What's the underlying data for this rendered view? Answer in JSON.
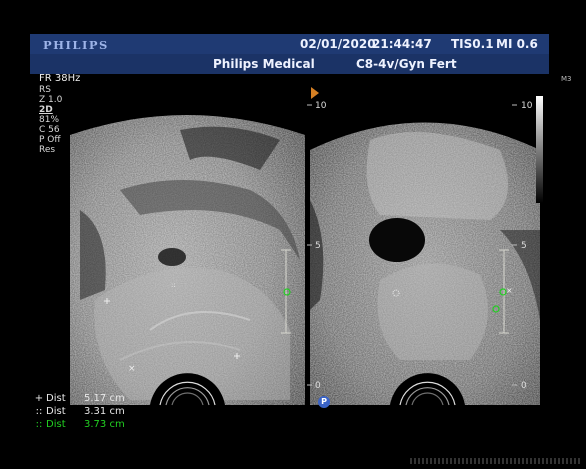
{
  "header": {
    "brand": "PHILIPS",
    "date": "02/01/2020",
    "time": "21:44:47",
    "tis": "TIS0.1",
    "mi": "MI 0.6",
    "institution": "Philips Medical",
    "probe_preset": "C8-4v/Gyn Fert"
  },
  "params": {
    "frame_rate": "FR 38Hz",
    "rs": "RS",
    "zoom": "Z 1.0",
    "mode": "2D",
    "gain": "81%",
    "compression": "C 56",
    "power": "P Off",
    "res": "Res"
  },
  "map_label": "M3",
  "depth_scale": {
    "left_top": "10",
    "left_mid": "5",
    "left_bottom": "0",
    "right_top": "10",
    "right_mid": "5",
    "right_bottom": "0"
  },
  "probe_indicator": "P",
  "measurements": [
    {
      "symbol": "+",
      "label": "Dist",
      "value": "5.17 cm",
      "color": "#e8e8e8"
    },
    {
      "symbol": "::",
      "label": "Dist",
      "value": "3.31 cm",
      "color": "#e8e8e8"
    },
    {
      "symbol": "::",
      "label": "Dist",
      "value": "3.73 cm",
      "color": "#22d022"
    }
  ],
  "colors": {
    "header": "#1f3a73",
    "orientation_marker": "#d58024",
    "green_caliper": "#22d022"
  }
}
